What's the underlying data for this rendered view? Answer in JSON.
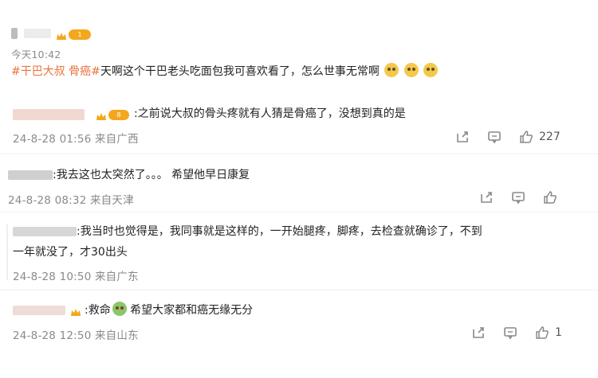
{
  "post": {
    "time": "今天10:42",
    "hashtag": "#干巴大叔 骨癌#",
    "text": "天啊这个干巴老头吃面包我可喜欢看了，怎么世事无常啊",
    "vip_badge": "1"
  },
  "comments": [
    {
      "text": ":之前说大叔的骨头疼就有人猜是骨癌了，没想到真的是",
      "meta": "24-8-28 01:56 来自广西",
      "likes": "227",
      "badge": "8"
    },
    {
      "text": ":我去这也太突然了。。。 希望他早日康复",
      "meta": "24-8-28 08:32 来自天津",
      "likes": ""
    },
    {
      "text_line1": ":我当时也觉得是，我同事就是这样的，一开始腿疼，脚疼，去检查就确诊了，不到",
      "text_line2": "一年就没了，才30出头",
      "meta": "24-8-28 10:50 来自广东",
      "likes": ""
    },
    {
      "text_a": ":救命",
      "text_b": "希望大家都和癌无缘无分",
      "meta": "24-8-28 12:50 来自山东",
      "likes": "1"
    }
  ],
  "icons": [
    "share-icon",
    "comment-icon",
    "like-icon",
    "crown-icon",
    "emoji-icon"
  ]
}
